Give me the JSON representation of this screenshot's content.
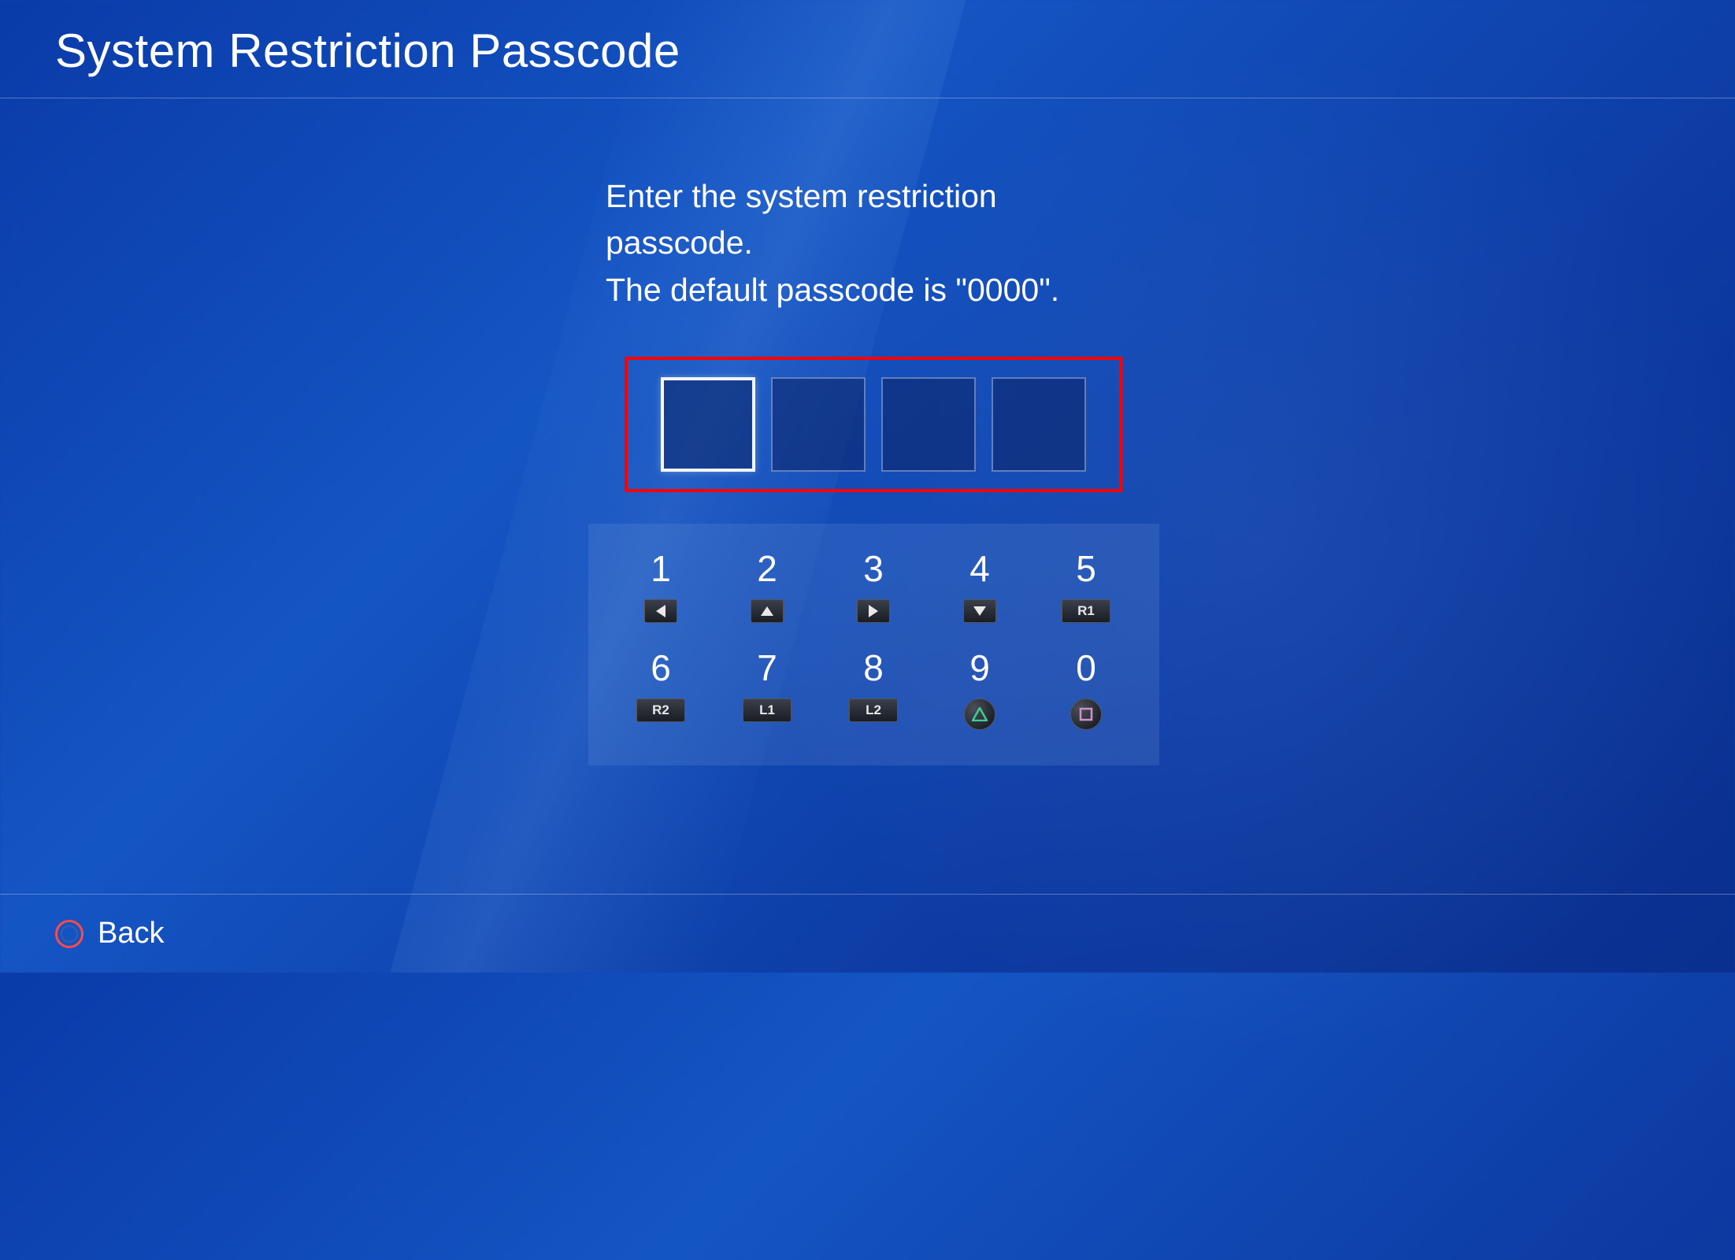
{
  "header": {
    "title": "System Restriction Passcode"
  },
  "instruction": {
    "line1": "Enter the system restriction passcode.",
    "line2": "The default passcode is \"0000\"."
  },
  "passcode": {
    "boxes": [
      {
        "active": true
      },
      {
        "active": false
      },
      {
        "active": false
      },
      {
        "active": false
      }
    ]
  },
  "keypad": {
    "keys": [
      {
        "digit": "1",
        "button_type": "arrow-left",
        "label": ""
      },
      {
        "digit": "2",
        "button_type": "arrow-up",
        "label": ""
      },
      {
        "digit": "3",
        "button_type": "arrow-right",
        "label": ""
      },
      {
        "digit": "4",
        "button_type": "arrow-down",
        "label": ""
      },
      {
        "digit": "5",
        "button_type": "text",
        "label": "R1"
      },
      {
        "digit": "6",
        "button_type": "text",
        "label": "R2"
      },
      {
        "digit": "7",
        "button_type": "text",
        "label": "L1"
      },
      {
        "digit": "8",
        "button_type": "text",
        "label": "L2"
      },
      {
        "digit": "9",
        "button_type": "triangle",
        "label": ""
      },
      {
        "digit": "0",
        "button_type": "square",
        "label": ""
      }
    ]
  },
  "footer": {
    "back_label": "Back"
  }
}
